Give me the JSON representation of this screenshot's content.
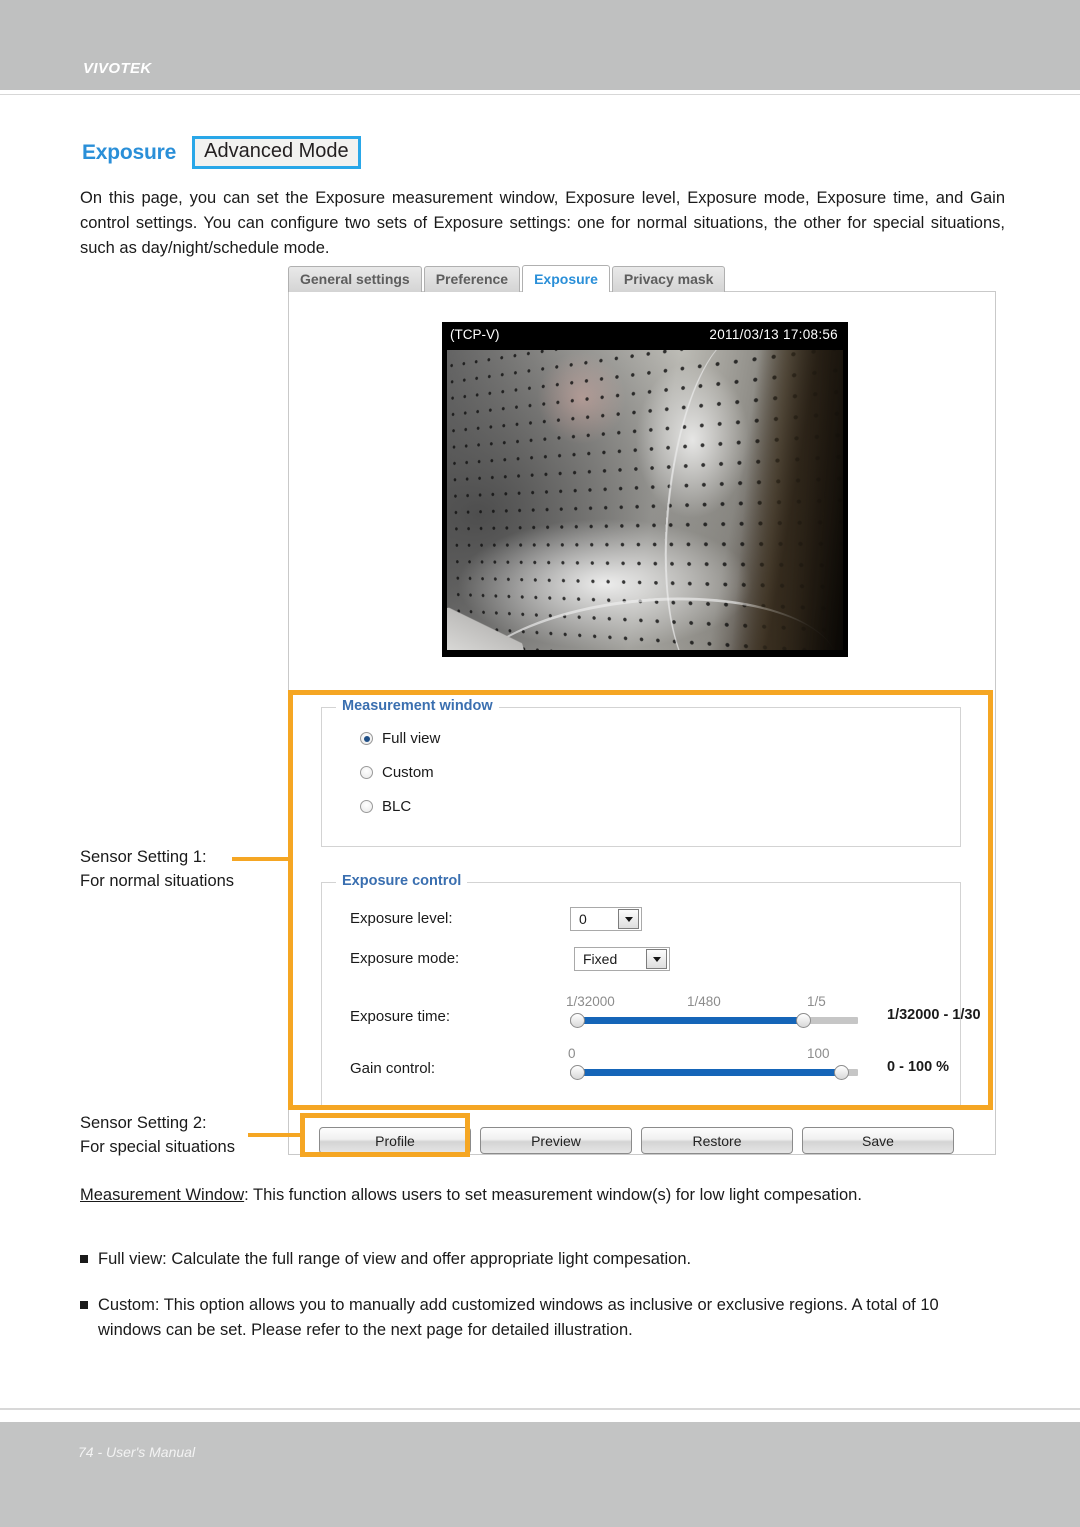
{
  "header": {
    "brand": "VIVOTEK"
  },
  "title": {
    "main": "Exposure",
    "badge": "Advanced Mode"
  },
  "intro": "On this page, you can set the Exposure measurement window, Exposure level, Exposure mode, Exposure time, and Gain control settings. You can configure two sets of Exposure settings: one for normal situations, the other for special situations, such as day/night/schedule mode.",
  "screenshot": {
    "tabs": [
      {
        "label": "General settings",
        "active": false
      },
      {
        "label": "Preference",
        "active": false
      },
      {
        "label": "Exposure",
        "active": true
      },
      {
        "label": "Privacy mask",
        "active": false
      }
    ],
    "video": {
      "stream_label": "(TCP-V)",
      "timestamp": "2011/03/13  17:08:56"
    },
    "measurement_window": {
      "legend": "Measurement window",
      "options": [
        {
          "label": "Full view",
          "selected": true
        },
        {
          "label": "Custom",
          "selected": false
        },
        {
          "label": "BLC",
          "selected": false
        }
      ]
    },
    "exposure_control": {
      "legend": "Exposure control",
      "exposure_level": {
        "label": "Exposure level:",
        "value": "0"
      },
      "exposure_mode": {
        "label": "Exposure mode:",
        "value": "Fixed"
      },
      "exposure_time": {
        "label": "Exposure time:",
        "ticks": [
          "1/32000",
          "1/480",
          "1/5"
        ],
        "range_text": "1/32000 - 1/30"
      },
      "gain_control": {
        "label": "Gain control:",
        "ticks": [
          "0",
          "100"
        ],
        "range_text": "0 - 100 %"
      }
    },
    "buttons": [
      "Profile",
      "Preview",
      "Restore",
      "Save"
    ]
  },
  "annotations": {
    "sensor1": "Sensor Setting 1:\nFor normal situations",
    "sensor1_line1": "Sensor Setting 1:",
    "sensor1_line2": "For normal situations",
    "sensor2_line1": "Sensor Setting 2:",
    "sensor2_line2": "For special situations",
    "highlight_color": "#f5a623"
  },
  "body": {
    "measurement_window_term": "Measurement Window",
    "measurement_window_desc": ": This function allows users to set measurement window(s) for low light compesation.",
    "bullet_full_view": "Full view: Calculate the full range of view and offer appropriate light compesation.",
    "bullet_custom": "Custom: This option allows you to manually add customized windows as inclusive or exclusive regions. A total of 10 windows can be set. Please refer to the next page for detailed illustration."
  },
  "footer": {
    "text": "74 - User's Manual"
  }
}
